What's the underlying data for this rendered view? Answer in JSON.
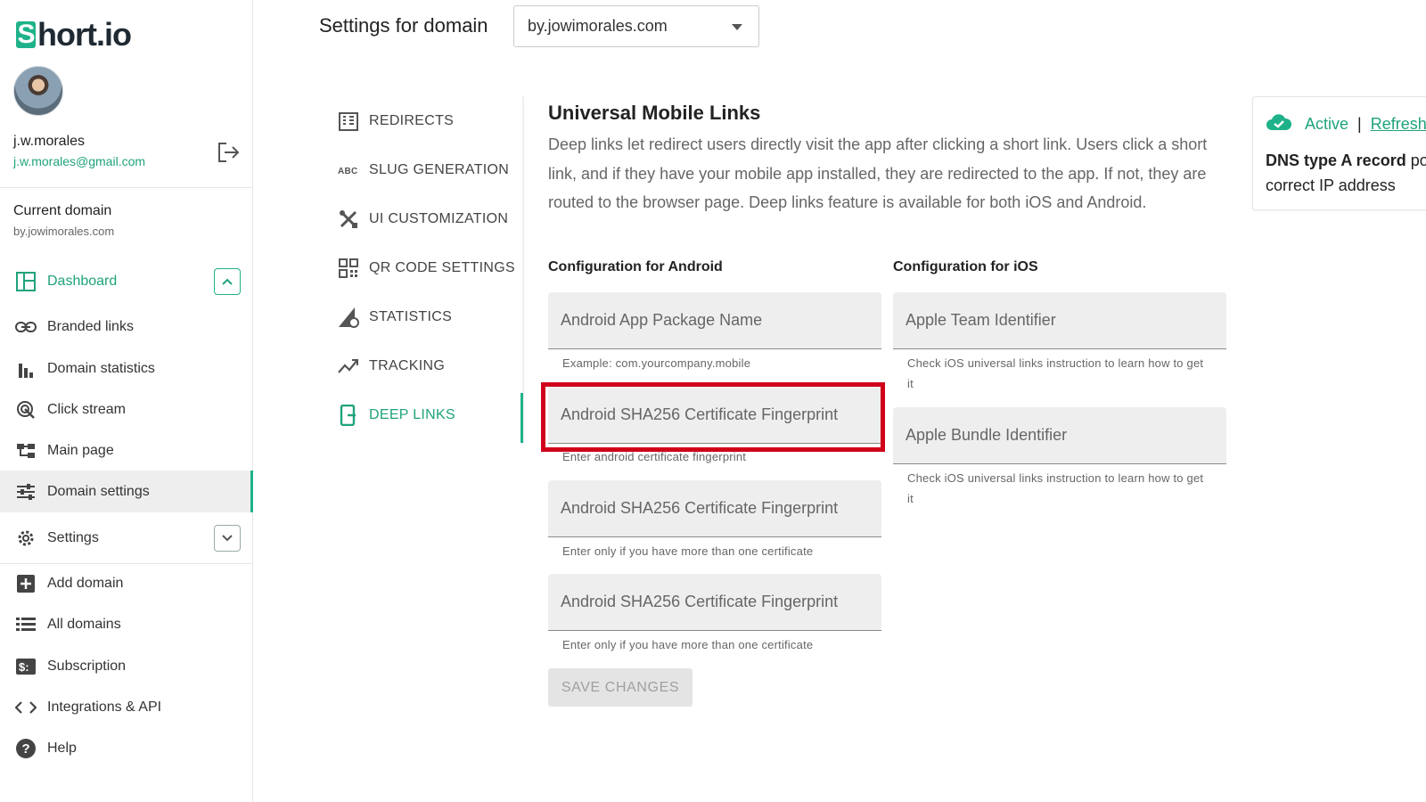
{
  "brand": {
    "logo_mark": "S",
    "logo_rest": "hort.io",
    "accent": "#1fb28a",
    "highlight": "#d0021b"
  },
  "user": {
    "name": "j.w.morales",
    "email": "j.w.morales@gmail.com"
  },
  "current_domain": {
    "label": "Current domain",
    "value": "by.jowimorales.com"
  },
  "sidebar": {
    "items": [
      {
        "label": "Dashboard",
        "icon": "dashboard-icon"
      },
      {
        "label": "Branded links",
        "icon": "link-icon"
      },
      {
        "label": "Domain statistics",
        "icon": "bar-chart-icon"
      },
      {
        "label": "Click stream",
        "icon": "click-icon"
      },
      {
        "label": "Main page",
        "icon": "sitemap-icon"
      },
      {
        "label": "Domain settings",
        "icon": "sliders-icon"
      },
      {
        "label": "Settings",
        "icon": "gear-icon"
      },
      {
        "label": "Add domain",
        "icon": "plus-square-icon"
      },
      {
        "label": "All domains",
        "icon": "list-icon"
      },
      {
        "label": "Subscription",
        "icon": "dollar-card-icon"
      },
      {
        "label": "Integrations & API",
        "icon": "code-icon"
      },
      {
        "label": "Help",
        "icon": "help-icon"
      }
    ]
  },
  "header": {
    "title": "Settings for domain",
    "selected_domain": "by.jowimorales.com"
  },
  "settings_menu": {
    "items": [
      {
        "label": "REDIRECTS",
        "icon": "building-icon"
      },
      {
        "label": "SLUG GENERATION",
        "icon": "abc-icon"
      },
      {
        "label": "UI CUSTOMIZATION",
        "icon": "tools-icon"
      },
      {
        "label": "QR CODE SETTINGS",
        "icon": "qr-icon"
      },
      {
        "label": "STATISTICS",
        "icon": "stats-gear-icon"
      },
      {
        "label": "TRACKING",
        "icon": "trend-icon"
      },
      {
        "label": "DEEP LINKS",
        "icon": "phone-link-icon"
      }
    ]
  },
  "main": {
    "title": "Universal Mobile Links",
    "description": "Deep links let redirect users directly visit the app after clicking a short link. Users click a short link, and if they have your mobile app installed, they are redirected to the app. If not, they are routed to the browser page. Deep links feature is available for both iOS and Android.",
    "android": {
      "heading": "Configuration for Android",
      "package_placeholder": "Android App Package Name",
      "package_hint": "Example: com.yourcompany.mobile",
      "fp1_placeholder": "Android SHA256 Certificate Fingerprint",
      "fp1_hint": "Enter android certificate fingerprint",
      "fp2_placeholder": "Android SHA256 Certificate Fingerprint",
      "fp2_hint": "Enter only if you have more than one certificate",
      "fp3_placeholder": "Android SHA256 Certificate Fingerprint",
      "fp3_hint": "Enter only if you have more than one certificate"
    },
    "ios": {
      "heading": "Configuration for iOS",
      "team_placeholder": "Apple Team Identifier",
      "team_hint": "Check iOS universal links instruction to learn how to get it",
      "bundle_placeholder": "Apple Bundle Identifier",
      "bundle_hint": "Check iOS universal links instruction to learn how to get it"
    },
    "save_label": "SAVE CHANGES"
  },
  "status": {
    "active": "Active",
    "separator": "|",
    "refresh": "Refresh",
    "dns_bold": "DNS type A record",
    "dns_rest_line1": " po",
    "dns_line2": "correct IP address"
  }
}
